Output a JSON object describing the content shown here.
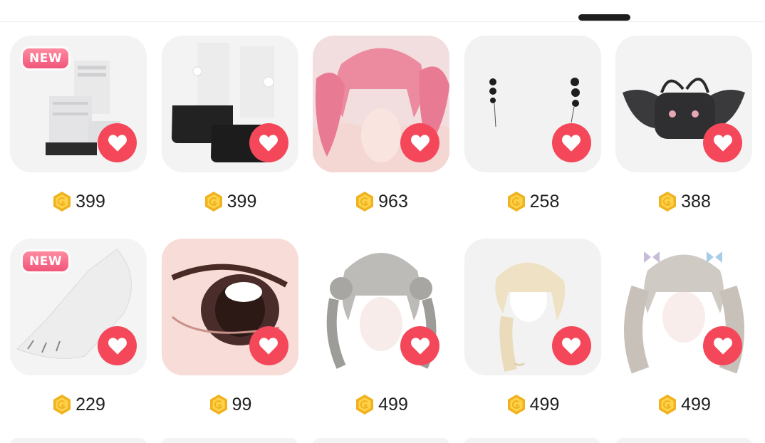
{
  "colors": {
    "favorite": "#f4485a",
    "coin": "#f0b21e",
    "new_badge": "#f0567a"
  },
  "badge_label": "NEW",
  "items": [
    {
      "name": "white chunky boots",
      "icon": "boots-icon",
      "price": "399",
      "badge": "NEW"
    },
    {
      "name": "white socks with black platform shoes",
      "icon": "platform-shoes-icon",
      "price": "399"
    },
    {
      "name": "pink twin-tail hair",
      "icon": "hair-icon",
      "price": "963"
    },
    {
      "name": "black bead earrings",
      "icon": "earrings-icon",
      "price": "258"
    },
    {
      "name": "black winged cat bag",
      "icon": "bag-icon",
      "price": "388"
    },
    {
      "name": "white glove with claws",
      "icon": "glove-icon",
      "price": "229",
      "badge": "NEW"
    },
    {
      "name": "brown eye",
      "icon": "eye-icon",
      "price": "99"
    },
    {
      "name": "silver bun twin-tail hair",
      "icon": "hair-icon",
      "price": "499"
    },
    {
      "name": "blonde braid hair",
      "icon": "hair-icon",
      "price": "499"
    },
    {
      "name": "silver pigtails with bows hair",
      "icon": "hair-icon",
      "price": "499"
    }
  ]
}
